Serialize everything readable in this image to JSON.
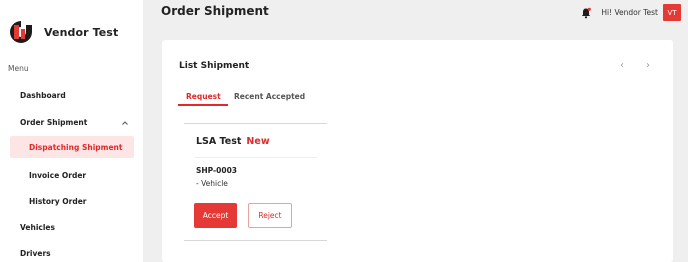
{
  "brand": {
    "name": "Vendor Test",
    "logo_icon": "vendor-logo-icon"
  },
  "sidebar": {
    "menu_label": "Menu",
    "items": [
      {
        "label": "Dashboard"
      },
      {
        "label": "Order Shipment",
        "expanded": true
      },
      {
        "label": "Dispatching Shipment",
        "active": true
      },
      {
        "label": "Invoice Order"
      },
      {
        "label": "History Order"
      },
      {
        "label": "Vehicles"
      },
      {
        "label": "Drivers"
      }
    ]
  },
  "header": {
    "title": "Order Shipment",
    "greeting": "Hi! Vendor Test",
    "avatar_initials": "VT",
    "notification_icon": "bell-icon"
  },
  "card": {
    "title": "List Shipment",
    "pager_prev": "‹",
    "pager_next": "›",
    "tabs": [
      {
        "label": "Request",
        "active": true
      },
      {
        "label": "Recent Accepted",
        "active": false
      }
    ]
  },
  "shipment": {
    "vendor": "LSA Test",
    "status": "New",
    "code": "SHP-0003",
    "vehicle_line": "- Vehicle",
    "accept_label": "Accept",
    "reject_label": "Reject"
  },
  "colors": {
    "accent": "#e53935",
    "active_bg": "#fde5e5",
    "main_bg": "#efefef"
  }
}
